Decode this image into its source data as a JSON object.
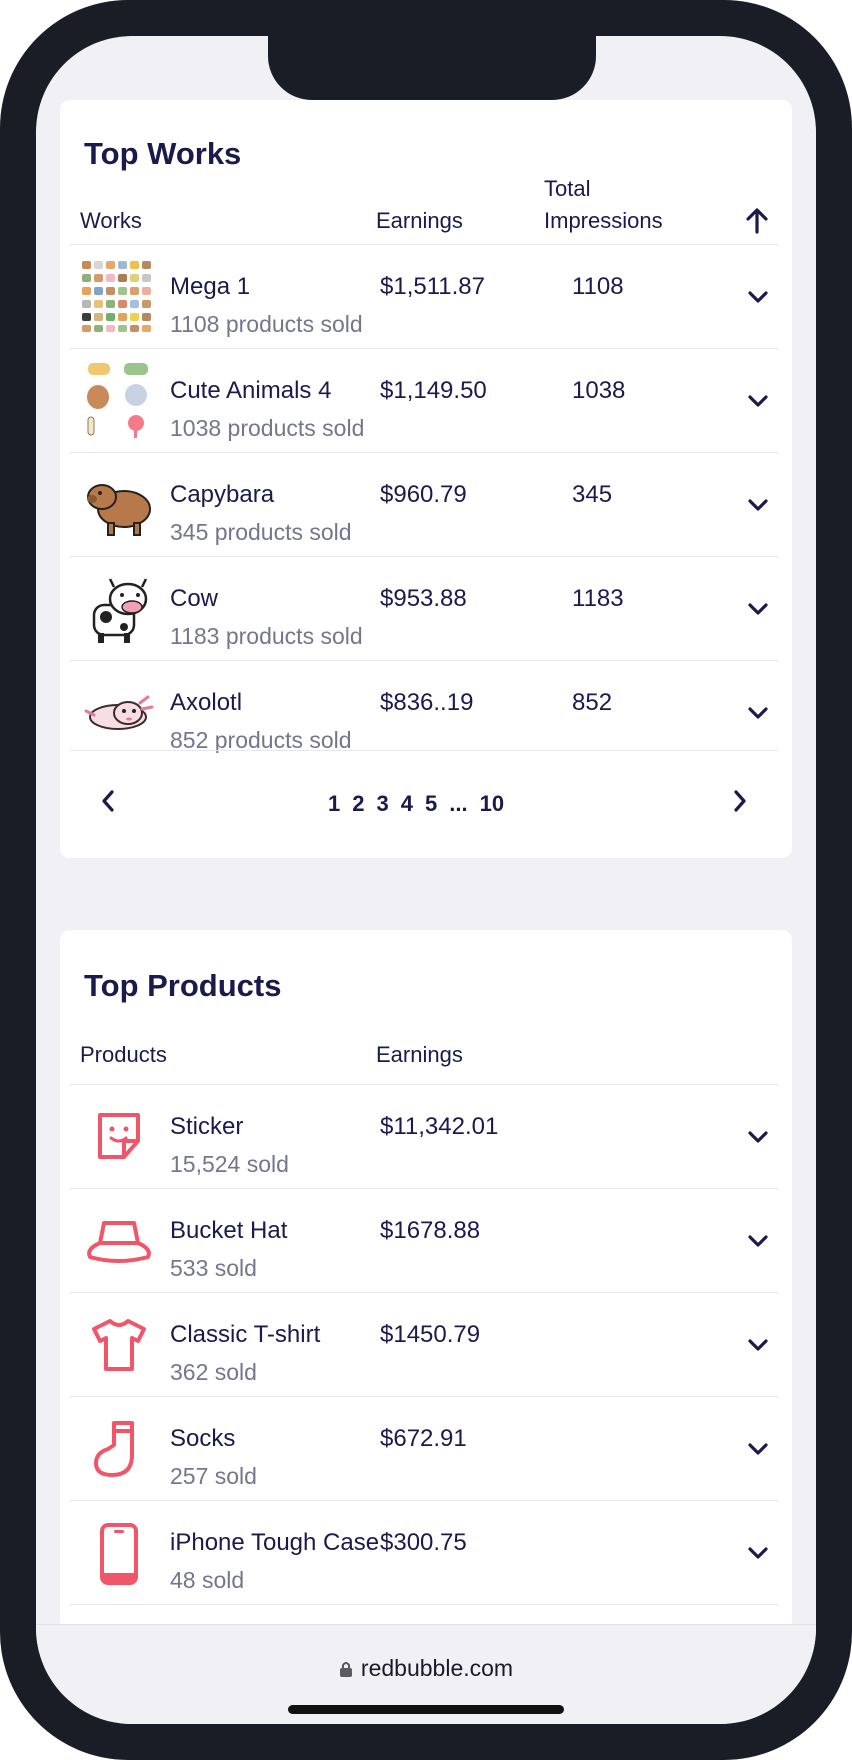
{
  "top_works": {
    "title": "Top Works",
    "col_works": "Works",
    "col_earnings": "Earnings",
    "col_impressions_line1": "Total",
    "col_impressions_line2": "Impressions",
    "sort_icon": "arrow-up-icon",
    "rows": [
      {
        "title": "Mega 1",
        "sub": "1108 products sold",
        "earnings": "$1,511.87",
        "impressions": "1108",
        "thumb": "sticker-grid"
      },
      {
        "title": "Cute Animals 4",
        "sub": "1038 products sold",
        "earnings": "$1,149.50",
        "impressions": "1038",
        "thumb": "animals"
      },
      {
        "title": "Capybara",
        "sub": "345 products sold",
        "earnings": "$960.79",
        "impressions": "345",
        "thumb": "capybara"
      },
      {
        "title": "Cow",
        "sub": "1183 products sold",
        "earnings": "$953.88",
        "impressions": "1183",
        "thumb": "cow"
      },
      {
        "title": "Axolotl",
        "sub": "852 products sold",
        "earnings": "$836..19",
        "impressions": "852",
        "thumb": "axolotl"
      }
    ],
    "pagination": {
      "pages": [
        "1",
        "2",
        "3",
        "4",
        "5",
        "...",
        "10"
      ]
    }
  },
  "top_products": {
    "title": "Top Products",
    "col_products": "Products",
    "col_earnings": "Earnings",
    "rows": [
      {
        "title": "Sticker",
        "sub": "15,524 sold",
        "earnings": "$11,342.01",
        "icon": "sticker-icon"
      },
      {
        "title": "Bucket Hat",
        "sub": "533 sold",
        "earnings": "$1678.88",
        "icon": "bucket-hat-icon"
      },
      {
        "title": "Classic T-shirt",
        "sub": "362 sold",
        "earnings": "$1450.79",
        "icon": "tshirt-icon"
      },
      {
        "title": "Socks",
        "sub": "257 sold",
        "earnings": "$672.91",
        "icon": "sock-icon"
      },
      {
        "title": "iPhone Tough Case",
        "sub": "48 sold",
        "earnings": "$300.75",
        "icon": "phone-case-icon"
      }
    ]
  },
  "browser": {
    "url": "redbubble.com"
  },
  "colors": {
    "text": "#1b1a4d",
    "muted": "#75758e",
    "accent": "#f0566a",
    "frame": "#1a1d26",
    "background": "#f1f1f5"
  }
}
